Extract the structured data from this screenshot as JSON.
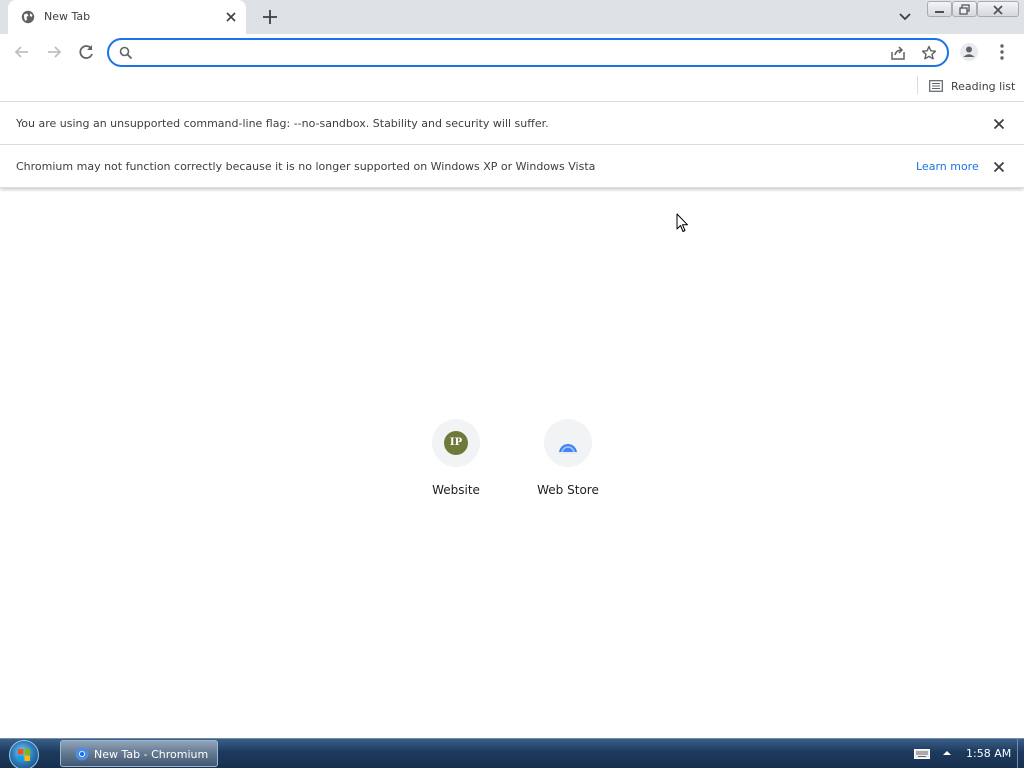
{
  "window": {
    "tab": {
      "title": "New Tab",
      "favicon": "globe-icon"
    },
    "controls": [
      "minimize-icon",
      "restore-icon",
      "close-icon"
    ]
  },
  "toolbar": {
    "omnibox": {
      "value": "",
      "placeholder": ""
    }
  },
  "bookmarks_bar": {
    "reading_list_label": "Reading list"
  },
  "infobars": [
    {
      "text": "You are using an unsupported command-line flag: --no-sandbox. Stability and security will suffer."
    },
    {
      "text": "Chromium may not function correctly because it is no longer supported on Windows XP or Windows Vista",
      "link": "Learn more"
    }
  ],
  "shortcuts": [
    {
      "label": "Website",
      "badge": "IP",
      "icon": "ip-site-icon"
    },
    {
      "label": "Web Store",
      "icon": "web-store-icon"
    }
  ],
  "taskbar": {
    "task_label": "New Tab - Chromium",
    "clock": "1:58 AM"
  },
  "colors": {
    "accent": "#1a73e8",
    "tabstrip": "#dee1e6",
    "taskbar": "#1d3a5e"
  }
}
